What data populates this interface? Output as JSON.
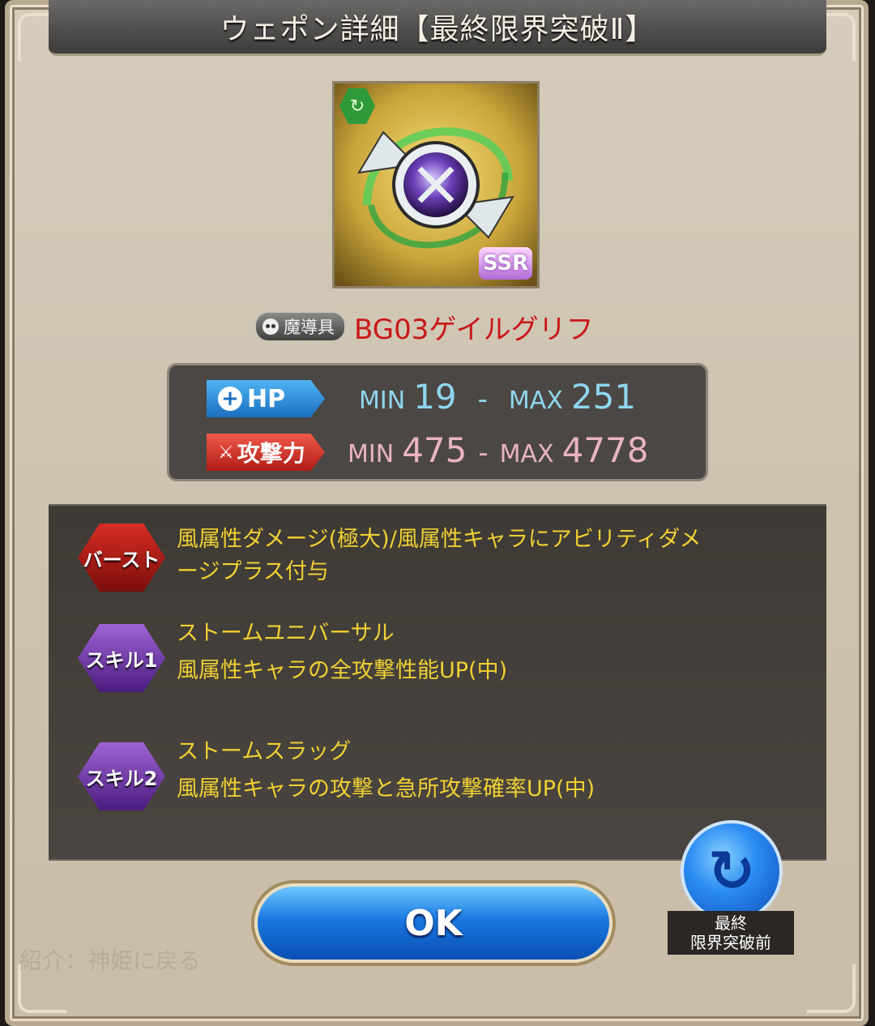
{
  "header": {
    "title": "ウェポン詳細【最終限界突破Ⅱ】"
  },
  "weapon": {
    "image_icon": "orb-weapon-icon",
    "rarity": "SSR",
    "element_icon": "wind-element-icon",
    "type_label": "魔導具",
    "type_icon": "skull-icon",
    "name": "BG03ゲイルグリフ"
  },
  "stats": {
    "hp": {
      "label": "HP",
      "min_label": "MIN",
      "min": "19",
      "dash": "-",
      "max_label": "MAX",
      "max": "251"
    },
    "atk": {
      "label": "攻撃力",
      "min_label": "MIN",
      "min": "475",
      "dash": "-",
      "max_label": "MAX",
      "max": "4778"
    }
  },
  "skills": [
    {
      "badge": "バースト",
      "line1": "風属性ダメージ(極大)/風属性キャラにアビリティダメ",
      "line2": "ージプラス付与"
    },
    {
      "badge": "スキル1",
      "line1": "ストームユニバーサル",
      "line2": "風属性キャラの全攻撃性能UP(中)"
    },
    {
      "badge": "スキル2",
      "line1": "ストームスラッグ",
      "line2": "風属性キャラの攻撃と急所攻撃確率UP(中)"
    }
  ],
  "footer": {
    "ok_label": "OK",
    "switch_caption_1": "最終",
    "switch_caption_2": "限界突破前",
    "background_text": "紹介：神姫に戻る"
  },
  "colors": {
    "name_red": "#c81818",
    "skill_yellow": "#f0d033",
    "hp_blue": "#8fd6ee",
    "atk_pink": "#e9b3c4"
  }
}
